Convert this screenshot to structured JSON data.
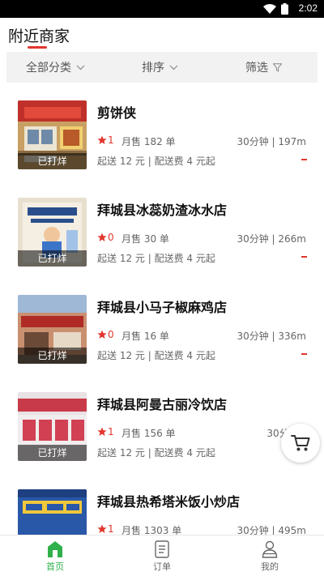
{
  "status_bar": {
    "time": "2:02"
  },
  "header": {
    "title": "附近商家"
  },
  "filters": [
    {
      "label": "全部分类"
    },
    {
      "label": "排序"
    },
    {
      "label": "筛选"
    }
  ],
  "shops": [
    {
      "name": "剪饼侠",
      "rating": "1",
      "sales": "月售 182 单",
      "distance": "30分钟 | 197m",
      "delivery": "起送 12 元 | 配送费 4 元起",
      "status": "已打烊"
    },
    {
      "name": "拜城县冰蕊奶渣冰水店",
      "rating": "0",
      "sales": "月售 30 单",
      "distance": "30分钟 | 266m",
      "delivery": "起送 12 元 | 配送费 4 元起",
      "status": "已打烊"
    },
    {
      "name": "拜城县小马子椒麻鸡店",
      "rating": "0",
      "sales": "月售 16 单",
      "distance": "30分钟 | 336m",
      "delivery": "起送 12 元 | 配送费 4 元起",
      "status": "已打烊"
    },
    {
      "name": "拜城县阿曼古丽冷饮店",
      "rating": "1",
      "sales": "月售 156 单",
      "distance": "30分钟 | 4",
      "delivery": "起送 12 元 | 配送费 4 元起",
      "status": "已打烊"
    },
    {
      "name": "拜城县热希塔米饭小炒店",
      "rating": "1",
      "sales": "月售 1303 单",
      "distance": "30分钟 | 495m",
      "delivery": "",
      "status": ""
    }
  ],
  "bottom_nav": [
    {
      "label": "首页",
      "icon": "home-icon",
      "active": true
    },
    {
      "label": "订单",
      "icon": "order-icon",
      "active": false
    },
    {
      "label": "我的",
      "icon": "user-icon",
      "active": false
    }
  ],
  "colors": {
    "accent": "#e2362f",
    "nav_active": "#2fb04a"
  }
}
